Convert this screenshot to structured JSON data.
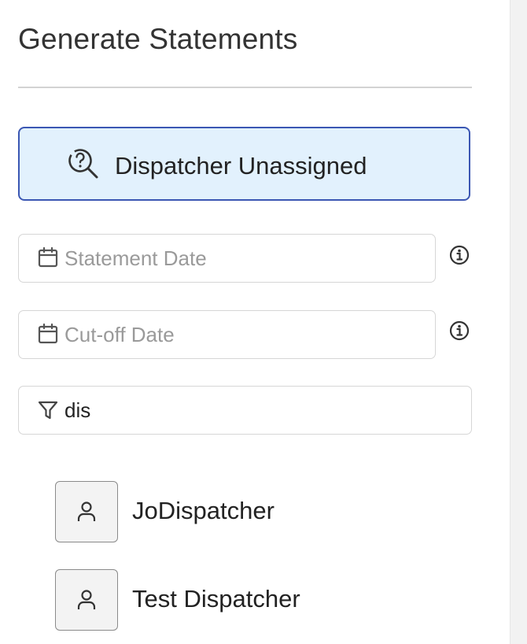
{
  "header": {
    "title": "Generate Statements"
  },
  "status_banner": {
    "label": "Dispatcher Unassigned",
    "icon": "search-question-icon",
    "background": "#e2f1fd",
    "border": "#3b57b3"
  },
  "statement_date": {
    "placeholder": "Statement Date",
    "value": "",
    "icon": "calendar-icon",
    "info_icon": "info-icon"
  },
  "cutoff_date": {
    "placeholder": "Cut-off Date",
    "value": "",
    "icon": "calendar-icon",
    "info_icon": "info-icon"
  },
  "filter": {
    "value": "dis",
    "placeholder": "",
    "icon": "filter-icon"
  },
  "dispatchers": [
    {
      "name": "JoDispatcher",
      "icon": "user-icon"
    },
    {
      "name": "Test Dispatcher",
      "icon": "user-icon"
    }
  ]
}
